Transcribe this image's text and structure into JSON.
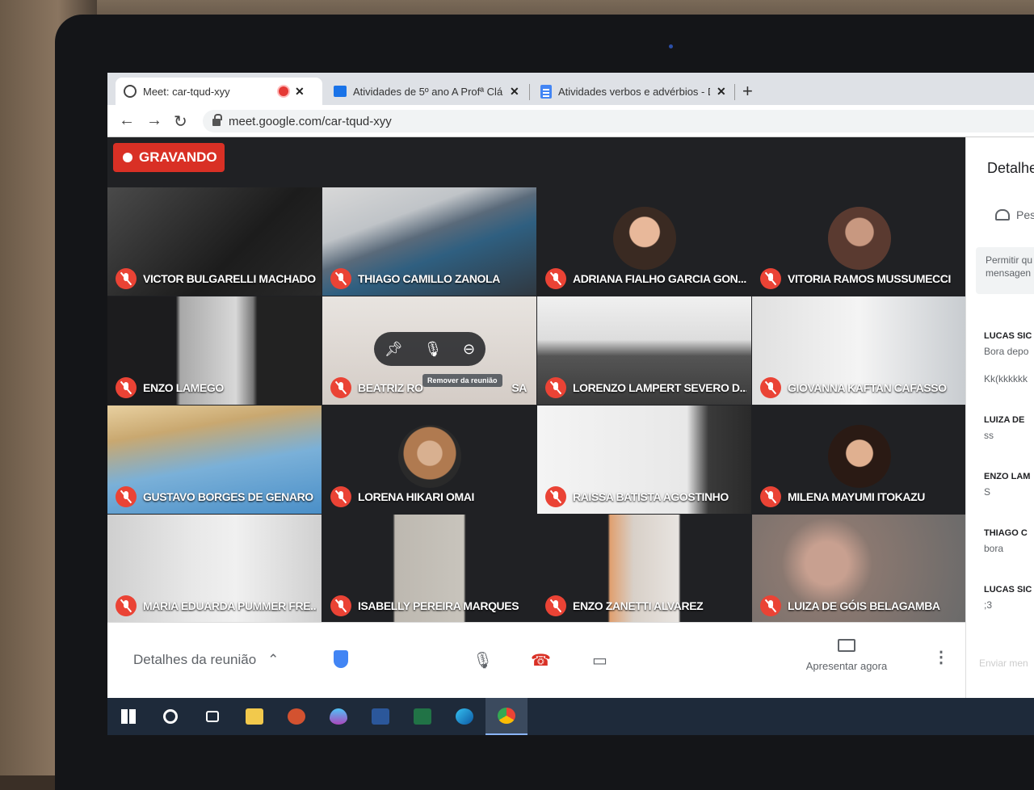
{
  "browser": {
    "tabs": [
      {
        "label": "Meet: car-tqud-xyy",
        "icon": "meet-icon",
        "recording_indicator": true
      },
      {
        "label": "Atividades de 5º ano A Profª Clá",
        "icon": "classroom-icon"
      },
      {
        "label": "Atividades verbos e advérbios - D",
        "icon": "docs-icon"
      }
    ],
    "new_tab": "+",
    "url": "meet.google.com/car-tqud-xyy"
  },
  "meet": {
    "recording_label": "GRAVANDO",
    "participants": [
      "VICTOR BULGARELLI MACHADO",
      "THIAGO CAMILLO ZANOLA",
      "ADRIANA FIALHO GARCIA GON...",
      "VITORIA RAMOS MUSSUMECCI",
      "ENZO LAMEGO",
      "BEATRIZ RO",
      "LORENZO LAMPERT SEVERO D...",
      "GIOVANNA KAFTAN CAFASSO",
      "GUSTAVO BORGES DE GENARO",
      "LORENA HIKARI OMAI",
      "RAISSA BATISTA AGOSTINHO",
      "MILENA MAYUMI ITOKAZU",
      "MARIA EDUARDA PUMMER FRE...",
      "ISABELLY PEREIRA MARQUES",
      "ENZO ZANETTI ALVAREZ",
      "LUIZA DE GÓIS BELAGAMBA"
    ],
    "tile_hover_tooltip": "Remover da reunião",
    "tile_hover_suffix": "SA",
    "bottom": {
      "details_label": "Detalhes da reunião",
      "present_label": "Apresentar agora"
    }
  },
  "side_panel": {
    "title": "Detalhe",
    "people_tab": "Pes",
    "allow_text": [
      "Permitir qu",
      "mensagen"
    ],
    "messages": [
      {
        "who": "LUCAS SIC",
        "text": "Bora depo"
      },
      {
        "who": "",
        "text": "Kk(kkkkkk"
      },
      {
        "who": "LUIZA DE",
        "text": "ss"
      },
      {
        "who": "ENZO LAM",
        "text": "S"
      },
      {
        "who": "THIAGO C",
        "text": "bora"
      },
      {
        "who": "LUCAS SIC",
        "text": ";3"
      }
    ],
    "send_placeholder": "Enviar men"
  },
  "taskbar": [
    "start-icon",
    "search-icon",
    "task-view-icon",
    "file-explorer-icon",
    "powerpoint-icon",
    "paint-drop-icon",
    "word-icon",
    "excel-icon",
    "edge-icon",
    "chrome-icon"
  ],
  "colors": {
    "recording": "#d93025",
    "mic_off": "#ea4335",
    "meet_bg": "#202124",
    "taskbar": "#1e2a3a"
  }
}
